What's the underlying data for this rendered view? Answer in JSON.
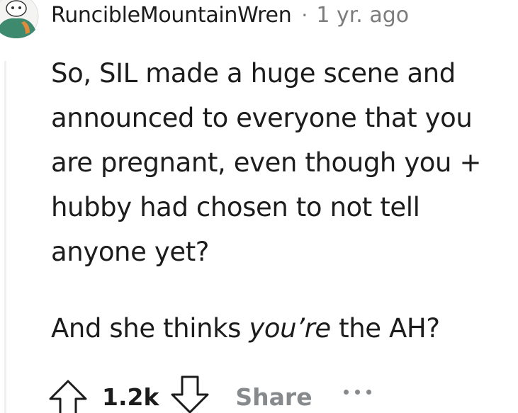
{
  "comment": {
    "username": "RuncibleMountainWren",
    "separator": "·",
    "timestamp": "1 yr. ago",
    "body": {
      "paragraph_1": "So, SIL made a huge scene and announced to everyone that you are pregnant, even though you + hubby had chosen to not tell anyone yet?",
      "paragraph_2_before": "And she thinks ",
      "paragraph_2_emphasis": "you’re",
      "paragraph_2_after": " the AH?"
    },
    "score": "1.2k",
    "share_label": "Share"
  },
  "icons": {
    "avatar": "snoo-avatar-icon",
    "upvote": "upvote-arrow-icon",
    "downvote": "downvote-arrow-icon",
    "more": "more-options-icon"
  },
  "colors": {
    "text_primary": "#1c1c1c",
    "text_meta": "#7c7c7c",
    "action_muted": "#878a8c",
    "thread_line": "#edeff1",
    "avatar_green": "#3e8a6e",
    "avatar_orange": "#e08a3c"
  }
}
